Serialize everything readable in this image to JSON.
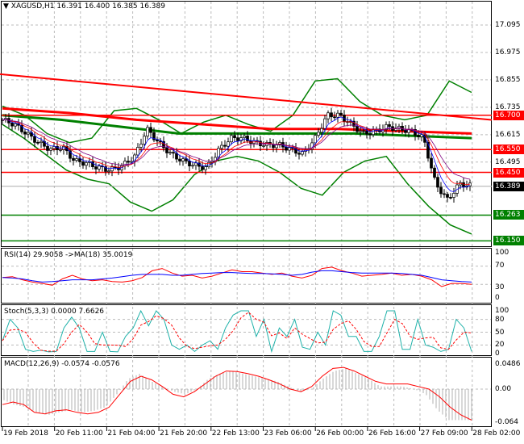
{
  "header": {
    "symbol": "XAGUSD,H1",
    "ohlc": "16.391 16.400 16.385 16.389"
  },
  "price_axis": [
    "17.095",
    "16.975",
    "16.855",
    "16.735",
    "16.615",
    "16.495"
  ],
  "levels": [
    {
      "label": "16.700",
      "value": 16.7,
      "color": "#ff0000"
    },
    {
      "label": "16.550",
      "value": 16.55,
      "color": "#ff0000"
    },
    {
      "label": "16.450",
      "value": 16.45,
      "color": "#ff0000"
    },
    {
      "label": "16.263",
      "value": 16.263,
      "color": "#008000"
    },
    {
      "label": "16.150",
      "value": 16.15,
      "color": "#008000"
    }
  ],
  "current": {
    "label": "16.389",
    "value": 16.389
  },
  "indicators": {
    "rsi": {
      "title": "RSI(14) 29.9058  ->MA(18) 35.0019",
      "axis": [
        "100",
        "70",
        "30",
        "0"
      ]
    },
    "stoch": {
      "title": "Stoch(5,3,3) 0.0000 7.6626",
      "axis": [
        "100",
        "80",
        "50",
        "20",
        "0"
      ]
    },
    "macd": {
      "title": "MACD(12,26,9) -0.0574 -0.0576",
      "axis": [
        "0.0486",
        "0.00",
        "-0.064"
      ]
    }
  },
  "dates": [
    "19 Feb 2018",
    "20 Feb 11:00",
    "21 Feb 04:00",
    "21 Feb 20:00",
    "22 Feb 13:00",
    "23 Feb 06:00",
    "26 Feb 00:00",
    "26 Feb 16:00",
    "27 Feb 09:00",
    "28 Feb 02:00"
  ],
  "chart_data": {
    "type": "line",
    "title": "XAGUSD,H1",
    "ylim": [
      16.12,
      17.2
    ],
    "close": [
      16.68,
      16.66,
      16.62,
      16.58,
      16.55,
      16.56,
      16.5,
      16.49,
      16.47,
      16.46,
      16.48,
      16.52,
      16.64,
      16.58,
      16.53,
      16.5,
      16.48,
      16.47,
      16.55,
      16.6,
      16.6,
      16.58,
      16.57,
      16.57,
      16.55,
      16.53,
      16.6,
      16.7,
      16.7,
      16.66,
      16.62,
      16.63,
      16.65,
      16.64,
      16.63,
      16.6,
      16.4,
      16.33,
      16.4,
      16.39
    ],
    "bb_upper": [
      16.74,
      16.7,
      16.62,
      16.58,
      16.6,
      16.72,
      16.73,
      16.68,
      16.62,
      16.67,
      16.7,
      16.66,
      16.63,
      16.7,
      16.85,
      16.86,
      16.76,
      16.7,
      16.68,
      16.7,
      16.85,
      16.8
    ],
    "bb_lower": [
      16.66,
      16.6,
      16.53,
      16.46,
      16.42,
      16.4,
      16.32,
      16.28,
      16.33,
      16.44,
      16.5,
      16.52,
      16.5,
      16.45,
      16.38,
      16.35,
      16.45,
      16.5,
      16.52,
      16.4,
      16.3,
      16.22,
      16.18
    ],
    "ma_green": [
      16.7,
      16.68,
      16.65,
      16.62,
      16.62,
      16.62,
      16.62,
      16.61,
      16.6
    ],
    "ma_red": [
      16.73,
      16.71,
      16.68,
      16.66,
      16.64,
      16.64,
      16.63,
      16.62
    ],
    "trendline": [
      16.88,
      16.68
    ],
    "rsi": [
      45,
      47,
      40,
      35,
      32,
      28,
      42,
      50,
      42,
      38,
      40,
      36,
      35,
      38,
      45,
      60,
      65,
      55,
      48,
      50,
      44,
      48,
      55,
      62,
      58,
      58,
      55,
      52,
      55,
      48,
      44,
      50,
      65,
      68,
      60,
      55,
      48,
      50,
      52,
      55,
      50,
      52,
      48,
      40,
      25,
      32,
      32,
      30
    ],
    "rsi_ma": [
      45,
      44,
      42,
      38,
      35,
      36,
      38,
      40,
      40,
      40,
      42,
      44,
      47,
      50,
      52,
      52,
      52,
      50,
      50,
      52,
      54,
      55,
      56,
      56,
      55,
      54,
      54,
      53,
      52,
      50,
      52,
      57,
      60,
      60,
      58,
      56,
      55,
      55,
      55,
      55,
      54,
      52,
      50,
      45,
      40,
      38,
      36,
      35
    ],
    "stoch": [
      30,
      80,
      60,
      10,
      5,
      8,
      4,
      5,
      60,
      85,
      60,
      5,
      5,
      50,
      5,
      4,
      40,
      60,
      100,
      65,
      100,
      80,
      20,
      10,
      20,
      5,
      20,
      30,
      10,
      60,
      90,
      100,
      100,
      40,
      80,
      5,
      60,
      40,
      80,
      15,
      10,
      50,
      20,
      100,
      90,
      40,
      40,
      5,
      5,
      40,
      100,
      100,
      10,
      10,
      80,
      20,
      15,
      5,
      10,
      80,
      60,
      5
    ],
    "macd_signal": [
      -0.03,
      -0.025,
      -0.03,
      -0.045,
      -0.048,
      -0.042,
      -0.04,
      -0.045,
      -0.048,
      -0.045,
      -0.035,
      -0.01,
      0.015,
      0.025,
      0.018,
      0.005,
      -0.01,
      -0.015,
      -0.005,
      0.01,
      0.025,
      0.035,
      0.034,
      0.03,
      0.025,
      0.018,
      0.01,
      0.0,
      -0.005,
      0.005,
      0.025,
      0.04,
      0.042,
      0.035,
      0.025,
      0.015,
      0.01,
      0.01,
      0.01,
      0.005,
      0.0,
      -0.015,
      -0.035,
      -0.05,
      -0.06
    ],
    "macd_hist": [
      -0.02,
      -0.03,
      -0.035,
      -0.045,
      -0.05,
      -0.045,
      -0.04,
      -0.045,
      -0.042,
      -0.035,
      -0.01,
      0.02,
      0.03,
      0.015,
      0.005,
      -0.005,
      -0.01,
      0.0,
      0.02,
      0.03,
      0.035,
      0.03,
      0.025,
      0.02,
      0.015,
      0.005,
      -0.005,
      0.0,
      0.02,
      0.035,
      0.04,
      0.03,
      0.02,
      0.005,
      0.005,
      0.005,
      0.0,
      -0.01,
      -0.04,
      -0.06,
      -0.06,
      -0.06
    ]
  }
}
